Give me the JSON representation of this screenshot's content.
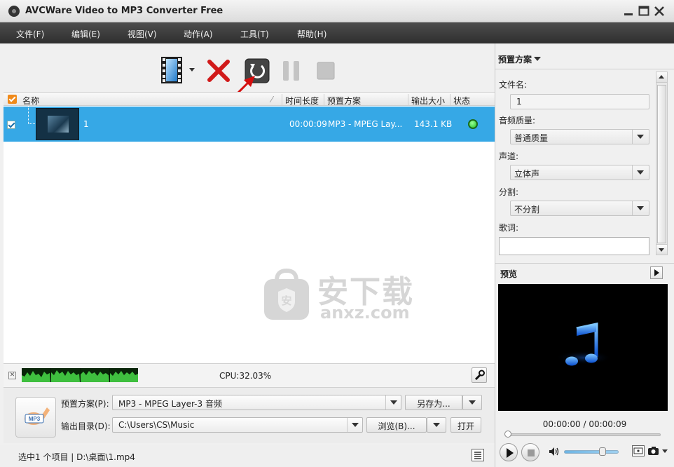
{
  "window": {
    "title": "AVCWare Video to MP3 Converter Free"
  },
  "menu": {
    "items": [
      "文件(F)",
      "编辑(E)",
      "视图(V)",
      "动作(A)",
      "工具(T)",
      "帮助(H)"
    ]
  },
  "list": {
    "columns": {
      "name": "名称",
      "duration": "时间长度",
      "profile": "预置方案",
      "output_size": "输出大小",
      "status": "状态"
    },
    "rows": [
      {
        "checked": true,
        "name": "1",
        "duration": "00:00:09",
        "profile": "MP3 - MPEG Lay...",
        "output_size": "143.1 KB",
        "status": "ready"
      }
    ]
  },
  "watermark": {
    "big_text": "安下载",
    "small_text": "anxz.com",
    "badge_text": "安"
  },
  "cpu": {
    "text": "CPU:32.03%"
  },
  "output": {
    "profile_label": "预置方案(P):",
    "profile_value": "MP3 - MPEG Layer-3 音频",
    "save_as_label": "另存为...",
    "dir_label": "输出目录(D):",
    "dir_value": "C:\\Users\\CS\\Music",
    "browse_label": "浏览(B)...",
    "open_label": "打开",
    "format_badge": "MP3"
  },
  "status_bar": {
    "text": "选中1 个项目 | D:\\桌面\\1.mp4"
  },
  "settings": {
    "header": "预置方案",
    "filename_label": "文件名:",
    "filename_value": "1",
    "quality_label": "音频质量:",
    "quality_value": "普通质量",
    "channel_label": "声道:",
    "channel_value": "立体声",
    "split_label": "分割:",
    "split_value": "不分割",
    "lyrics_label": "歌词:"
  },
  "preview": {
    "label": "预览",
    "time": "00:00:00 / 00:00:09",
    "position": 0,
    "volume": 0.65
  },
  "colors": {
    "selected_row": "#36a8e6",
    "menubar": "#3a3a3a",
    "status_ok": "#21c321",
    "accent_red": "#d11a1a"
  }
}
